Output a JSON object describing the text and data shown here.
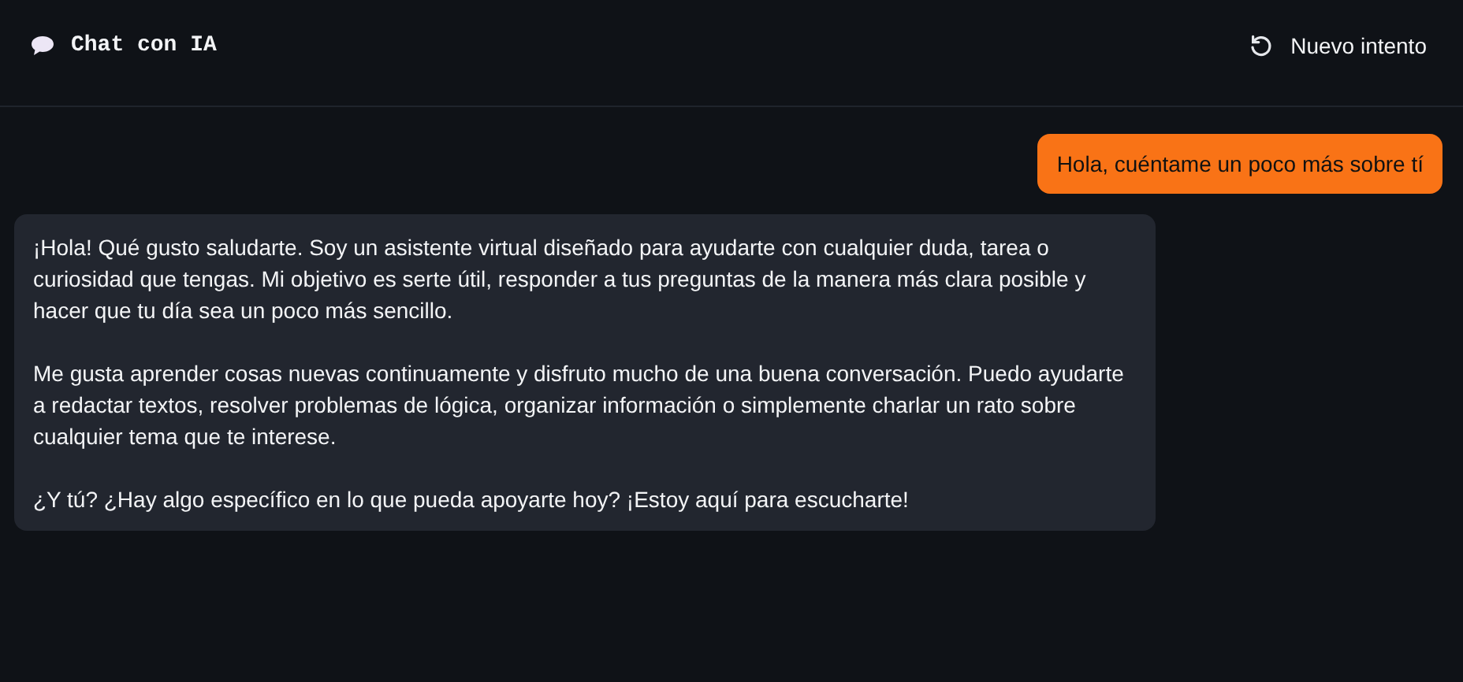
{
  "header": {
    "title": "Chat con IA",
    "retry_button": "Nuevo intento"
  },
  "messages": [
    {
      "kind": "user",
      "paragraphs": [
        "Hola, cuéntame un poco más sobre tí"
      ]
    },
    {
      "kind": "assistant",
      "paragraphs": [
        "¡Hola! Qué gusto saludarte. Soy un asistente virtual diseñado para ayudarte con cualquier duda, tarea o curiosidad que tengas. Mi objetivo es serte útil, responder a tus preguntas de la manera más clara posible y hacer que tu día sea un poco más sencillo.",
        "Me gusta aprender cosas nuevas continuamente y disfruto mucho de una buena conversación. Puedo ayudarte a redactar textos, resolver problemas de lógica, organizar información o simplemente charlar un rato sobre cualquier tema que te interese.",
        "¿Y tú? ¿Hay algo específico en lo que pueda apoyarte hoy? ¡Estoy aquí para escucharte!"
      ]
    }
  ]
}
